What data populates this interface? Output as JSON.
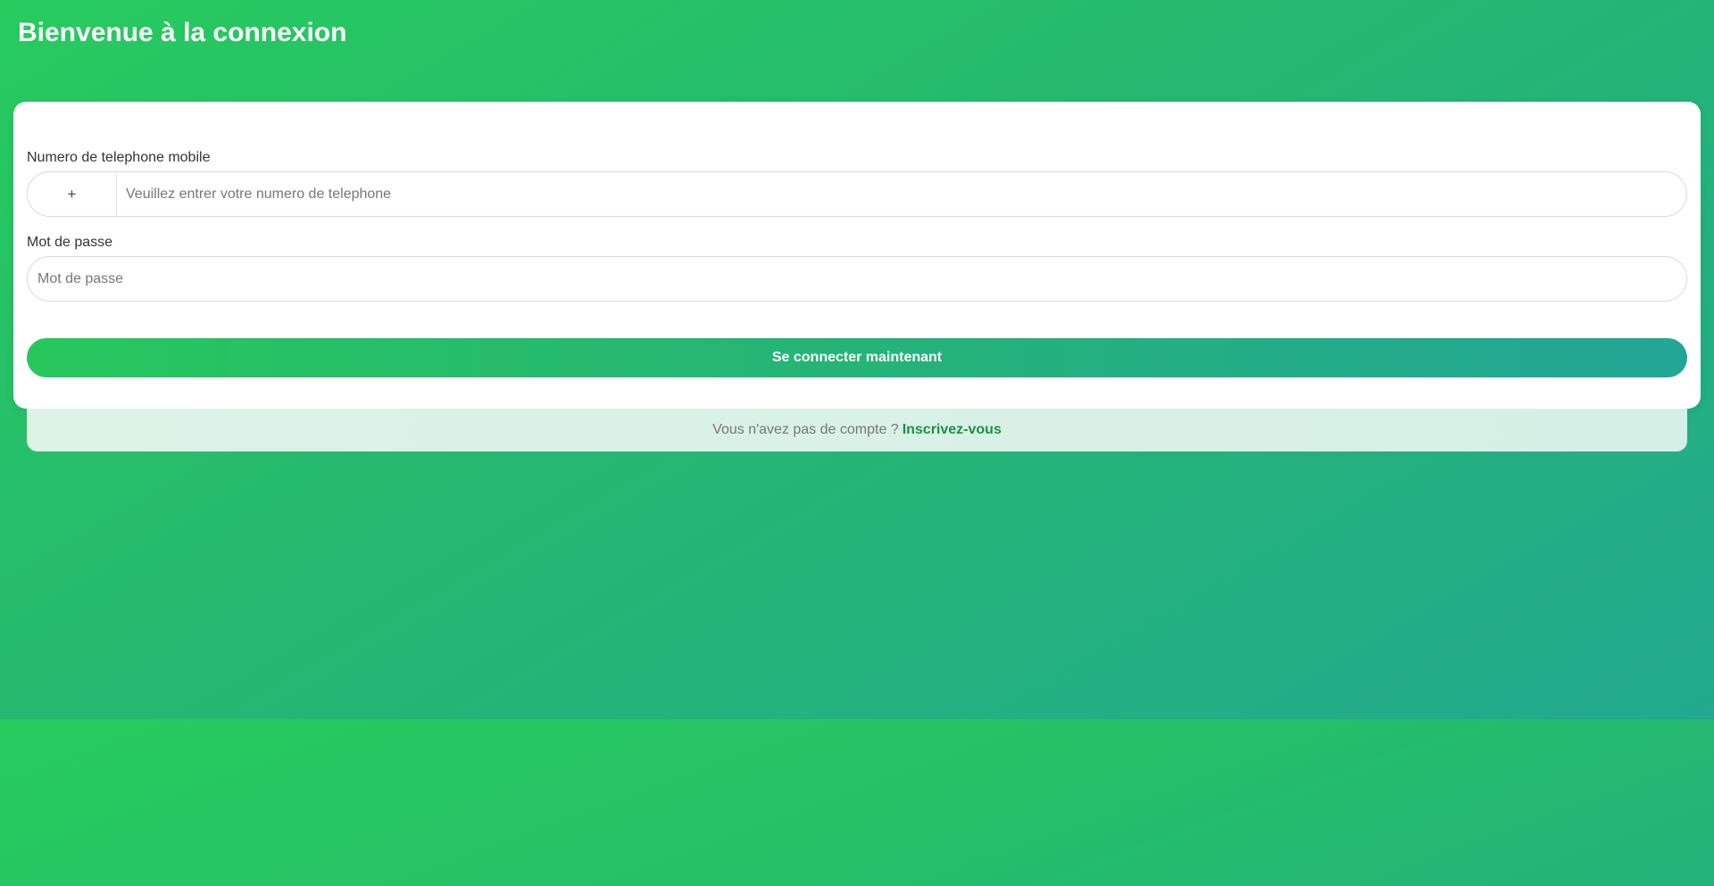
{
  "header": {
    "title": "Bienvenue à la connexion"
  },
  "login_form": {
    "phone": {
      "label": "Numero de telephone mobile",
      "country_code": "+",
      "placeholder": "Veuillez entrer votre numero de telephone",
      "value": ""
    },
    "password": {
      "label": "Mot de passe",
      "placeholder": "Mot de passe",
      "value": ""
    },
    "submit_label": "Se connecter maintenant"
  },
  "signup": {
    "prompt": "Vous n'avez pas de compte ?",
    "link_label": "Inscrivez-vous"
  },
  "colors": {
    "background_start": "#26cb5f",
    "background_end": "#22a98d",
    "card": "#ffffff",
    "link": "#1e8f46"
  }
}
